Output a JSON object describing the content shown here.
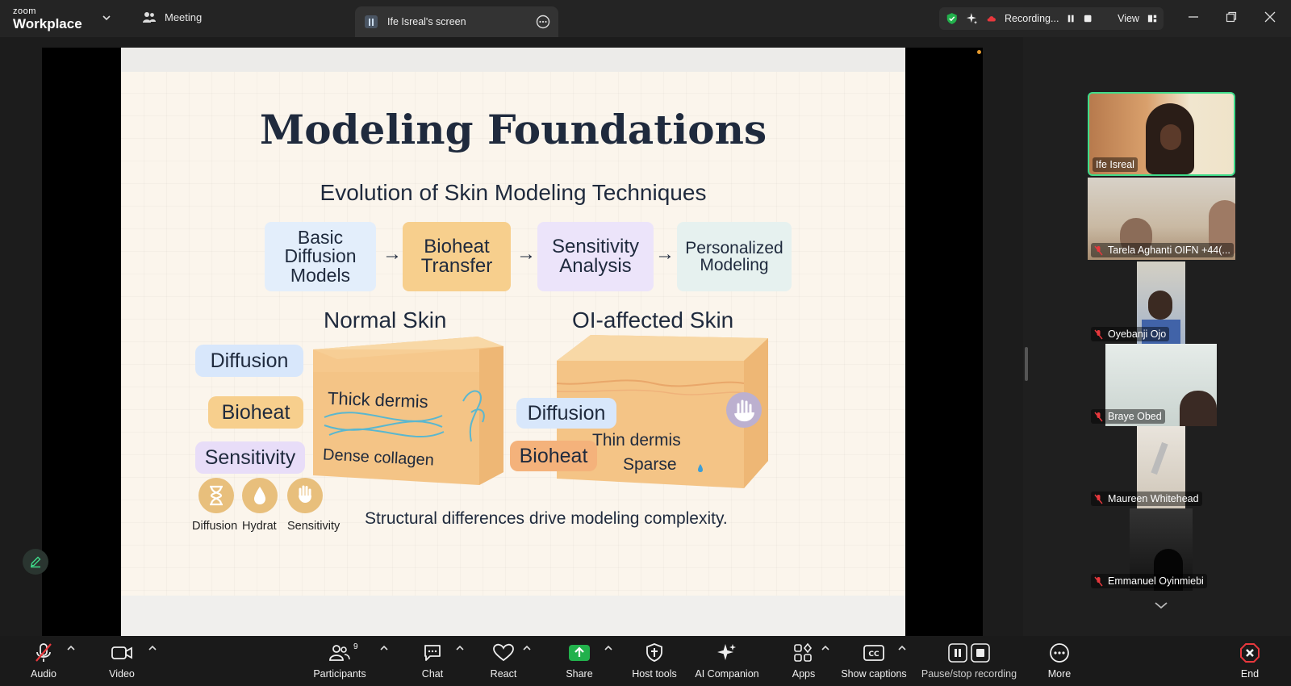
{
  "app": {
    "brand_top": "zoom",
    "brand_bottom": "Workplace",
    "meeting_tab": "Meeting",
    "screen_tab": "Ife Isreal's screen"
  },
  "recording": {
    "status": "Recording...",
    "view_label": "View"
  },
  "slide": {
    "title": "Modeling Foundations",
    "subtitle": "Evolution of Skin Modeling Techniques",
    "steps": [
      {
        "line1": "Basic",
        "line2": "Diffusion",
        "line3": "Models"
      },
      {
        "line1": "Bioheat",
        "line2": "Transfer"
      },
      {
        "line1": "Sensitivity",
        "line2": "Analysis"
      },
      {
        "line1": "Personalized",
        "line2": "Modeling"
      }
    ],
    "arrow": "→",
    "normal_title": "Normal Skin",
    "affected_title": "OI-affected Skin",
    "normal_tags": [
      "Diffusion",
      "Bioheat",
      "Sensitivity"
    ],
    "normal_cube_text1": "Thick dermis",
    "normal_cube_text2": "Dense collagen",
    "affected_tags": [
      "Diffusion",
      "Bioheat"
    ],
    "affected_cube_text1": "Thin dermis",
    "affected_cube_text2": "Sparse",
    "icon_labels": [
      "Diffusion",
      "Hydrat",
      "Sensitivity"
    ],
    "footer": "Structural differences drive modeling complexity."
  },
  "participants": [
    {
      "name": "Ife Isreal",
      "muted": false,
      "active": true
    },
    {
      "name": "Tarela Aghanti OIFN +44(...",
      "muted": true
    },
    {
      "name": "Oyebanji Ojo",
      "muted": true
    },
    {
      "name": "Braye Obed",
      "muted": true
    },
    {
      "name": "Maureen Whitehead",
      "muted": true
    },
    {
      "name": "Emmanuel Oyinmiebi",
      "muted": true
    }
  ],
  "toolbar": {
    "audio": "Audio",
    "video": "Video",
    "participants": "Participants",
    "participants_count": "9",
    "chat": "Chat",
    "react": "React",
    "share": "Share",
    "host_tools": "Host tools",
    "ai_companion": "AI Companion",
    "apps": "Apps",
    "show_captions": "Show captions",
    "pause_stop": "Pause/stop recording",
    "more": "More",
    "end": "End"
  },
  "colors": {
    "share_green": "#22b14c",
    "active_border": "#3fdc8a",
    "end_red": "#e8383d",
    "step1_bg": "#e3eefb",
    "step2_bg": "#f7cf8d",
    "step3_bg": "#ece4fa",
    "step4_bg": "#e6f1ef"
  }
}
